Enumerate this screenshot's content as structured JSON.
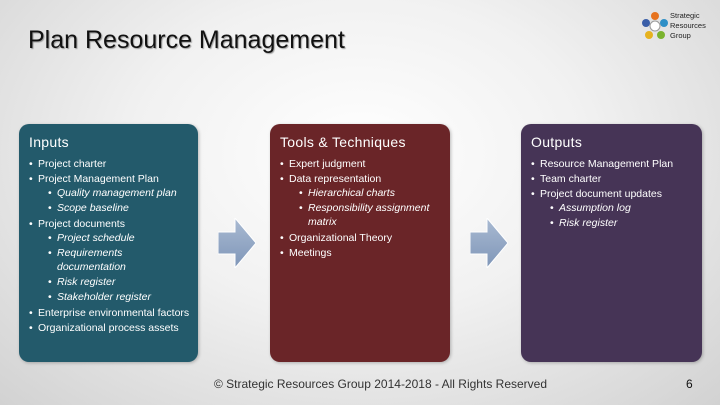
{
  "slide": {
    "title": "Plan Resource Management",
    "logo": {
      "line1": "Strategic",
      "line2": "Resources",
      "line3": "Group",
      "icon": "people-circle-logo-icon"
    },
    "panels": {
      "inputs": {
        "heading": "Inputs",
        "color": "#235a6b",
        "items": [
          {
            "text": "Project charter",
            "level": 1
          },
          {
            "text": "Project Management Plan",
            "level": 1
          },
          {
            "text": "Quality management plan",
            "level": 2
          },
          {
            "text": "Scope baseline",
            "level": 2
          },
          {
            "text": "Project documents",
            "level": 1
          },
          {
            "text": "Project schedule",
            "level": 2
          },
          {
            "text": "Requirements documentation",
            "level": 2
          },
          {
            "text": "Risk register",
            "level": 2
          },
          {
            "text": "Stakeholder register",
            "level": 2
          },
          {
            "text": "Enterprise environmental factors",
            "level": 1
          },
          {
            "text": "Organizational process assets",
            "level": 1
          }
        ]
      },
      "tools": {
        "heading": "Tools & Techniques",
        "color": "#6a2528",
        "items": [
          {
            "text": "Expert judgment",
            "level": 1
          },
          {
            "text": "Data representation",
            "level": 1
          },
          {
            "text": "Hierarchical charts",
            "level": 2
          },
          {
            "text": "Responsibility assignment matrix",
            "level": 2
          },
          {
            "text": "Organizational Theory",
            "level": 1
          },
          {
            "text": "Meetings",
            "level": 1
          }
        ]
      },
      "outputs": {
        "heading": "Outputs",
        "color": "#463456",
        "items": [
          {
            "text": "Resource Management Plan",
            "level": 1
          },
          {
            "text": "Team charter",
            "level": 1
          },
          {
            "text": "Project document updates",
            "level": 1
          },
          {
            "text": "Assumption log",
            "level": 2
          },
          {
            "text": "Risk register",
            "level": 2
          }
        ]
      }
    },
    "arrow_icon": "right-arrow-icon",
    "arrow_color": "#8ea3c2",
    "footer": "© Strategic Resources Group 2014-2018 - All Rights Reserved",
    "page_number": "6"
  }
}
